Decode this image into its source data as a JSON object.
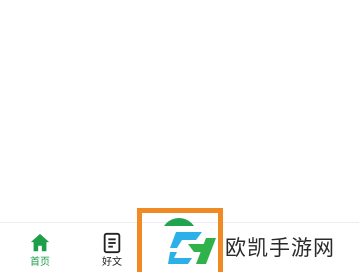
{
  "tabbar": {
    "items": [
      {
        "label": "首页",
        "icon": "home-icon",
        "active": true
      },
      {
        "label": "好文",
        "icon": "document-icon",
        "active": false
      }
    ],
    "active_color": "#1f9e4a",
    "center_button_color": "#22a34f",
    "highlight_color": "#f08a24"
  },
  "watermark": {
    "text": "欧凯手游网",
    "logo": "ok-logo-icon",
    "colors": [
      "#2bb1e8",
      "#2fb24a"
    ]
  }
}
